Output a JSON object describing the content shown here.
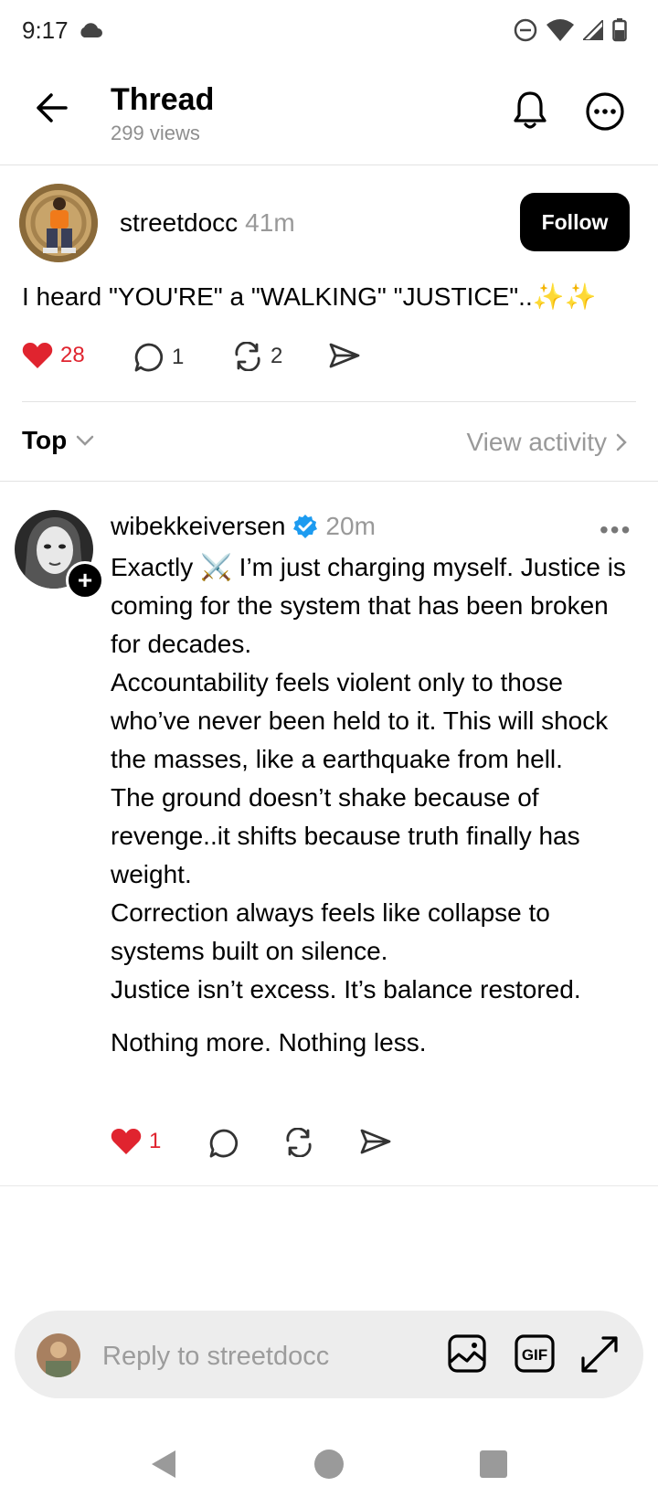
{
  "status_bar": {
    "time": "9:17"
  },
  "header": {
    "title": "Thread",
    "views": "299 views"
  },
  "post": {
    "username": "streetdocc",
    "time": "41m",
    "follow_label": "Follow",
    "text": "I heard \"YOU'RE\" a \"WALKING\" \"JUSTICE\"..✨✨",
    "likes": "28",
    "comments": "1",
    "reposts": "2"
  },
  "sort": {
    "label": "Top",
    "view_activity": "View activity"
  },
  "reply": {
    "username": "wibekkeiversen",
    "time": "20m",
    "text": "Exactly ⚔️ I’m just charging myself. Justice is coming for the system that has been broken for decades.\nAccountability feels violent only to those who’ve never been held to it. This will shock the masses, like a earthquake from hell.\nThe ground doesn’t shake because of revenge..it shifts because truth finally has weight.\nCorrection always feels like collapse to systems built on silence.\nJustice isn’t excess. It’s balance restored.",
    "text2": "Nothing more. Nothing less.",
    "likes": "1"
  },
  "composer": {
    "placeholder": "Reply to streetdocc"
  },
  "colors": {
    "like_red": "#e0242f",
    "verified_blue": "#1d9bf0",
    "follow_bg": "#000000"
  }
}
